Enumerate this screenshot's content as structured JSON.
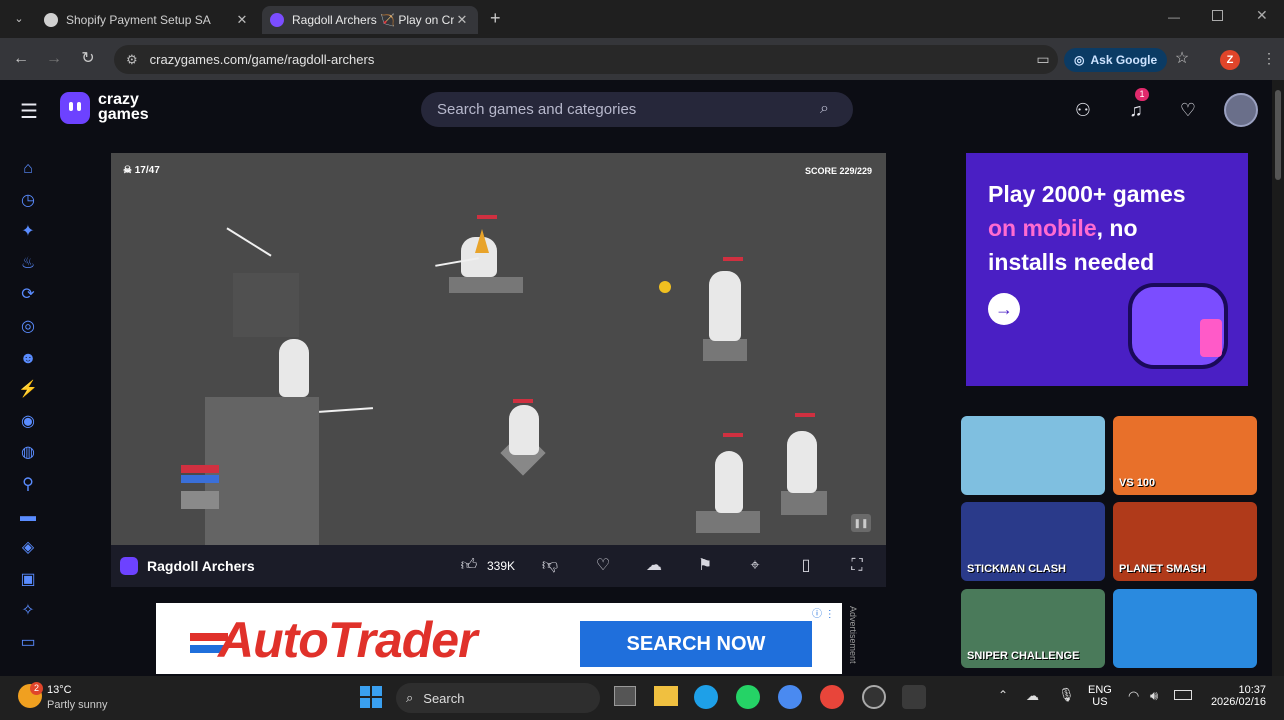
{
  "tabs": [
    {
      "title": "Shopify Payment Setup SA",
      "close": "✕",
      "favicon_color": "#d0d0d0"
    },
    {
      "title": "Ragdoll Archers 🏹 Play on CrazyGames",
      "close": "✕",
      "favicon_color": "#7b4dff"
    }
  ],
  "new_tab": "+",
  "url": "crazygames.com/game/ragdoll-archers",
  "ask_google": "Ask Google",
  "profile_initial": "Z",
  "site": {
    "logo_top": "crazy",
    "logo_bottom": "games",
    "search_placeholder": "Search games and categories",
    "notification_count": "1",
    "sidebar_icons": [
      "home-icon",
      "recent-icon",
      "new-icon",
      "trending-icon",
      "updated-icon",
      "originals-icon",
      "multiplayer-icon",
      "action-icon",
      "adventure-icon",
      "basketball-icon",
      "stickman-icon",
      "car-icon",
      "clicker-icon",
      "controller-icon",
      "shooting-icon",
      "gamepad-icon"
    ]
  },
  "game": {
    "hud_left": "17/47",
    "hud_right": "SCORE 229/229",
    "title": "Ragdoll Archers",
    "like_count": "339K"
  },
  "ad": {
    "brand": "AutoTrader",
    "cta": "SEARCH NOW",
    "side_label": "Advertisement"
  },
  "promo": {
    "line1": "Play 2000+ games",
    "line2_highlight": "on mobile",
    "line2_rest": ", no",
    "line3": "installs needed"
  },
  "thumbs": [
    {
      "label": "",
      "color": "#7fbfe0"
    },
    {
      "label": "VS 100",
      "color": "#e8702a"
    },
    {
      "label": "STICKMAN CLASH",
      "color": "#2a3a8a"
    },
    {
      "label": "PLANET SMASH",
      "color": "#b03a1a"
    },
    {
      "label": "SNIPER CHALLENGE",
      "color": "#4a7a5a"
    },
    {
      "label": "",
      "color": "#2a8adf"
    }
  ],
  "taskbar": {
    "temp": "13°C",
    "weather": "Partly sunny",
    "weather_badge": "2",
    "search": "Search",
    "lang1": "ENG",
    "lang2": "US",
    "time": "10:37",
    "date": "2026/02/16"
  }
}
